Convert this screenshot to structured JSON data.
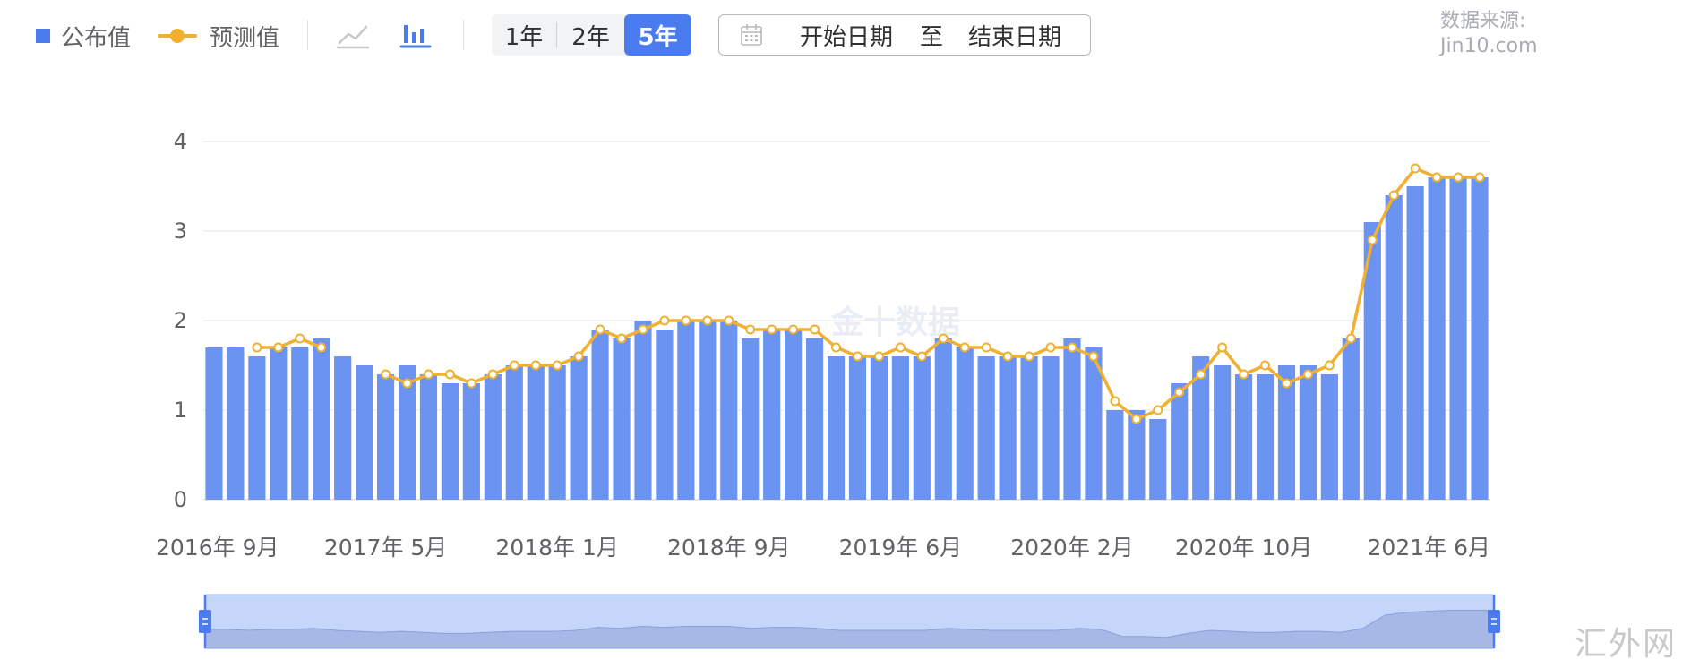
{
  "legend": {
    "published_label": "公布值",
    "forecast_label": "预测值",
    "line_icon": "line-chart-icon",
    "bar_icon": "bar-chart-icon"
  },
  "range_selector": {
    "options": [
      "1年",
      "2年",
      "5年"
    ],
    "selected": "5年"
  },
  "date_range": {
    "icon": "calendar-icon",
    "start_placeholder": "开始日期",
    "separator": "至",
    "end_placeholder": "结束日期"
  },
  "source": {
    "label": "数据来源:",
    "site": "Jin10.com"
  },
  "chart_watermark": "金十数据",
  "corner_watermark": "汇外网",
  "colors": {
    "bar": "#6b93f2",
    "forecast": "#f0b030",
    "accent": "#4a7cf0",
    "grid": "#e6e6e6"
  },
  "chart_data": {
    "type": "bar",
    "ylim": [
      0,
      4
    ],
    "yticks": [
      0,
      1,
      2,
      3,
      4
    ],
    "categories": [
      "2016年 9月",
      "2016年 10月",
      "2016年 11月",
      "2016年 12月",
      "2017年 1月",
      "2017年 2月",
      "2017年 3月",
      "2017年 4月",
      "2017年 5月",
      "2017年 6月",
      "2017年 7月",
      "2017年 8月",
      "2017年 9月",
      "2017年 10月",
      "2017年 11月",
      "2017年 12月",
      "2018年 1月",
      "2018年 2月",
      "2018年 3月",
      "2018年 4月",
      "2018年 5月",
      "2018年 6月",
      "2018年 7月",
      "2018年 8月",
      "2018年 9月",
      "2018年 10月",
      "2018年 11月",
      "2018年 12月",
      "2019年 1月",
      "2019年 2月",
      "2019年 3月",
      "2019年 4月",
      "2019年 6月",
      "2019年 7月",
      "2019年 8月",
      "2019年 9月",
      "2019年 10月",
      "2019年 11月",
      "2019年 12月",
      "2020年 1月",
      "2020年 2月",
      "2020年 3月",
      "2020年 4月",
      "2020年 5月",
      "2020年 6月",
      "2020年 7月",
      "2020年 8月",
      "2020年 9月",
      "2020年 10月",
      "2020年 11月",
      "2020年 12月",
      "2021年 1月",
      "2021年 2月",
      "2021年 3月",
      "2021年 4月",
      "2021年 5月",
      "2021年 6月",
      "2021年 7月",
      "2021年 8月",
      "2021年 9月"
    ],
    "tick_labels": [
      {
        "index": 0,
        "text": "2016年 9月"
      },
      {
        "index": 8,
        "text": "2017年 5月"
      },
      {
        "index": 16,
        "text": "2018年 1月"
      },
      {
        "index": 24,
        "text": "2018年 9月"
      },
      {
        "index": 32,
        "text": "2019年 6月"
      },
      {
        "index": 40,
        "text": "2020年 2月"
      },
      {
        "index": 48,
        "text": "2020年 10月"
      },
      {
        "index": 56,
        "text": "2021年 6月"
      }
    ],
    "series": [
      {
        "name": "公布值",
        "kind": "bar",
        "values": [
          1.7,
          1.7,
          1.6,
          1.7,
          1.7,
          1.8,
          1.6,
          1.5,
          1.4,
          1.5,
          1.4,
          1.3,
          1.3,
          1.4,
          1.5,
          1.5,
          1.5,
          1.6,
          1.9,
          1.8,
          2.0,
          1.9,
          2.0,
          2.0,
          2.0,
          1.8,
          1.9,
          1.9,
          1.8,
          1.6,
          1.6,
          1.6,
          1.6,
          1.6,
          1.8,
          1.7,
          1.6,
          1.6,
          1.6,
          1.6,
          1.8,
          1.7,
          1.0,
          1.0,
          0.9,
          1.3,
          1.6,
          1.5,
          1.4,
          1.4,
          1.5,
          1.5,
          1.4,
          1.8,
          3.1,
          3.4,
          3.5,
          3.6,
          3.6,
          3.6
        ]
      },
      {
        "name": "预测值",
        "kind": "line",
        "values": [
          null,
          null,
          1.7,
          1.7,
          1.8,
          1.7,
          null,
          null,
          1.4,
          1.3,
          1.4,
          1.4,
          1.3,
          1.4,
          1.5,
          1.5,
          1.5,
          1.6,
          1.9,
          1.8,
          1.9,
          2.0,
          2.0,
          2.0,
          2.0,
          1.9,
          1.9,
          1.9,
          1.9,
          1.7,
          1.6,
          1.6,
          1.7,
          1.6,
          1.8,
          1.7,
          1.7,
          1.6,
          1.6,
          1.7,
          1.7,
          1.6,
          1.1,
          0.9,
          1.0,
          1.2,
          1.4,
          1.7,
          1.4,
          1.5,
          1.3,
          1.4,
          1.5,
          1.8,
          2.9,
          3.4,
          3.7,
          3.6,
          3.6,
          3.6
        ]
      }
    ]
  }
}
